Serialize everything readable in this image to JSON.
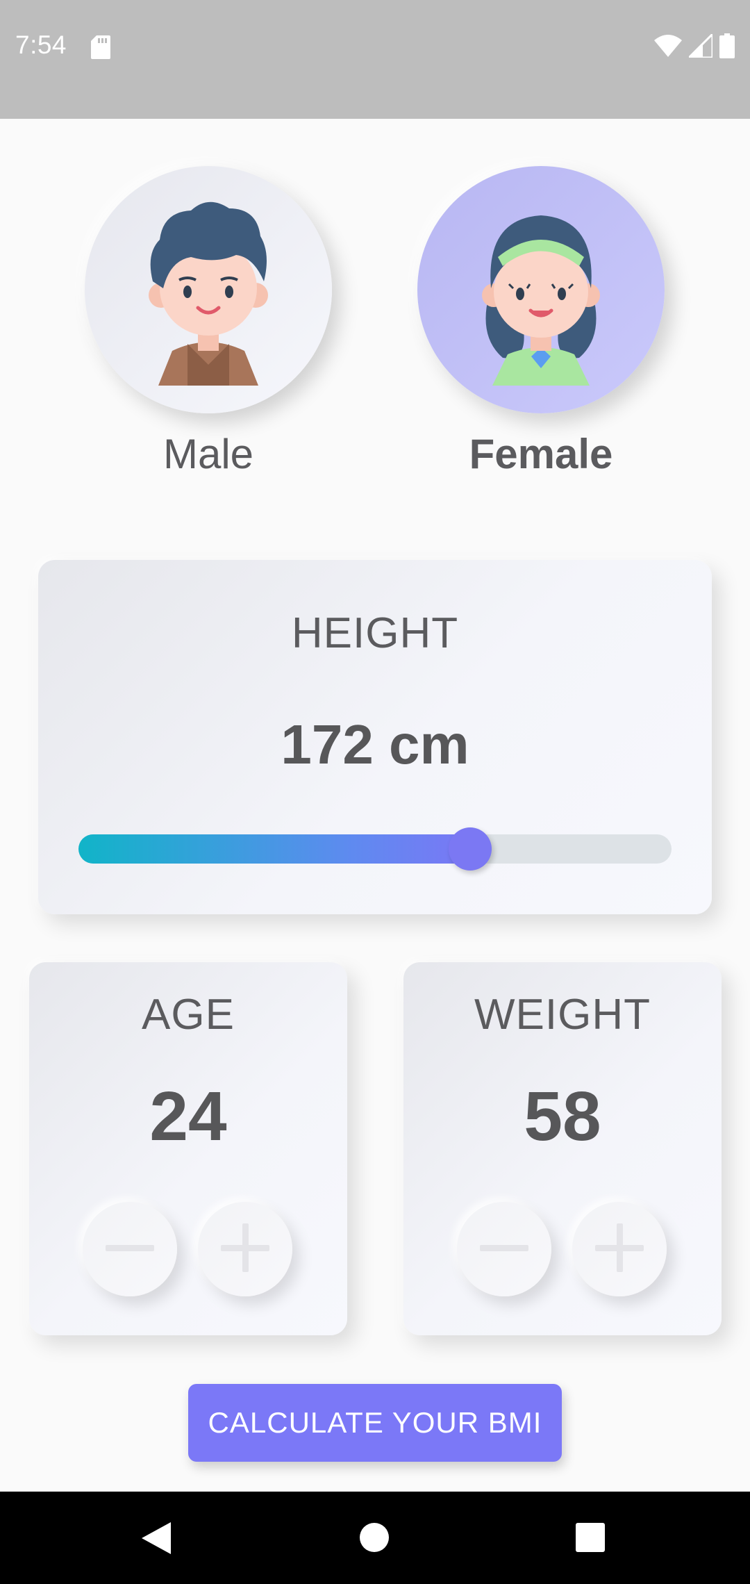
{
  "status_bar": {
    "time": "7:54",
    "icons": [
      "sd-card-icon",
      "wifi-icon",
      "signal-icon",
      "battery-icon"
    ]
  },
  "gender": {
    "selected": "Female",
    "male": {
      "label": "Male",
      "icon": "male-avatar-icon"
    },
    "female": {
      "label": "Female",
      "icon": "female-avatar-icon"
    }
  },
  "height": {
    "title": "HEIGHT",
    "value_text": "172 cm",
    "slider_fraction": 0.66
  },
  "age": {
    "title": "AGE",
    "value": "24",
    "minus_icon": "minus-icon",
    "plus_icon": "plus-icon"
  },
  "weight": {
    "title": "WEIGHT",
    "value": "58",
    "minus_icon": "minus-icon",
    "plus_icon": "plus-icon"
  },
  "calculate_button": {
    "label": "CALCULATE YOUR BMI"
  },
  "nav_bar": {
    "icons": [
      "back-icon",
      "home-icon",
      "recents-icon"
    ]
  },
  "colors": {
    "accent": "#7B78F7",
    "slider_start": "#11B4C8",
    "female_bg": "#C3C2F8",
    "text": "#5B5B5E"
  }
}
